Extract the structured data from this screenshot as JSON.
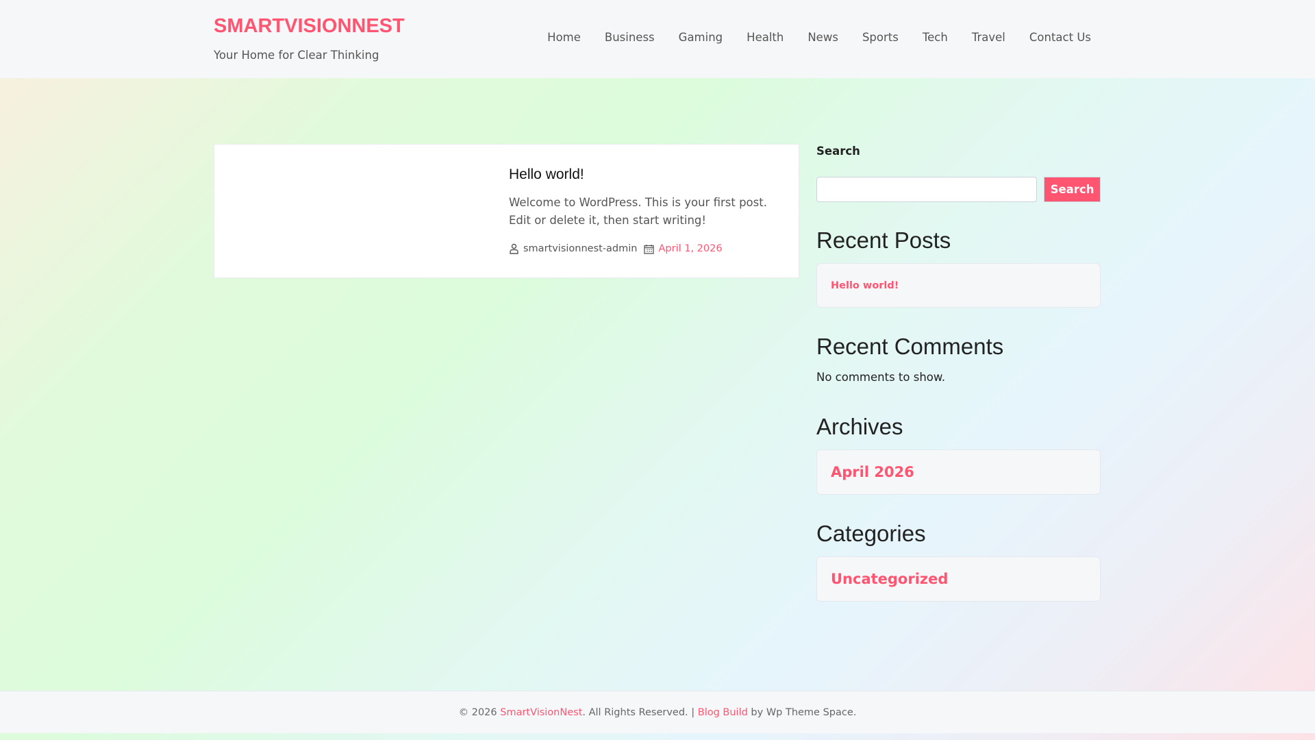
{
  "site": {
    "title": "SMARTVISIONNEST",
    "tagline": "Your Home for Clear Thinking"
  },
  "nav": [
    "Home",
    "Business",
    "Gaming",
    "Health",
    "News",
    "Sports",
    "Tech",
    "Travel",
    "Contact Us"
  ],
  "post": {
    "title": "Hello world!",
    "excerpt": "Welcome to WordPress. This is your first post. Edit or delete it, then start writing!",
    "author": "smartvisionnest-admin",
    "date": "April 1, 2026"
  },
  "sidebar": {
    "search_label": "Search",
    "search_value": "",
    "search_button": "Search",
    "recent_posts_title": "Recent Posts",
    "recent_posts": [
      "Hello world!"
    ],
    "recent_comments_title": "Recent Comments",
    "recent_comments_empty": "No comments to show.",
    "archives_title": "Archives",
    "archives": [
      "April 2026"
    ],
    "categories_title": "Categories",
    "categories": [
      "Uncategorized"
    ]
  },
  "footer": {
    "prefix": "© 2026 ",
    "site_link": "SmartVisionNest",
    "middle": ". All Rights Reserved. | ",
    "theme_link": "Blog Build",
    "suffix": " by Wp Theme Space."
  },
  "colors": {
    "accent": "#ff5571"
  }
}
